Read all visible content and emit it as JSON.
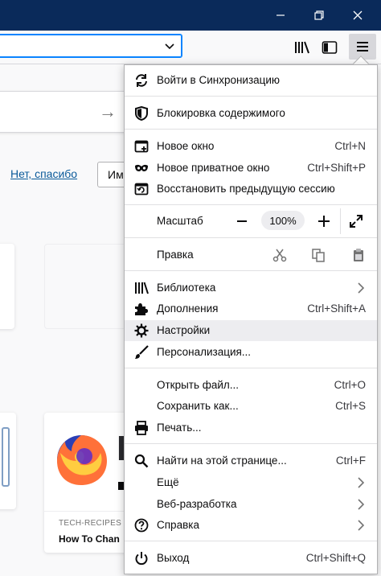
{
  "page": {
    "no_thanks": "Нет, спасибо",
    "partial_button": "Им",
    "card_source": "TECH-RECIPES",
    "card_title": "How To Chan",
    "card_big_letter": "F"
  },
  "menu": {
    "sync": "Войти в Синхронизацию",
    "content_blocking": "Блокировка содержимого",
    "new_window": "Новое окно",
    "new_window_sc": "Ctrl+N",
    "private_window": "Новое приватное окно",
    "private_window_sc": "Ctrl+Shift+P",
    "restore_session": "Восстановить предыдущую сессию",
    "zoom_label": "Масштаб",
    "zoom_value": "100%",
    "edit_label": "Правка",
    "library": "Библиотека",
    "addons": "Дополнения",
    "addons_sc": "Ctrl+Shift+A",
    "settings": "Настройки",
    "customize": "Персонализация...",
    "open_file": "Открыть файл...",
    "open_file_sc": "Ctrl+O",
    "save_as": "Сохранить как...",
    "save_as_sc": "Ctrl+S",
    "print": "Печать...",
    "find": "Найти на этой странице...",
    "find_sc": "Ctrl+F",
    "more": "Ещё",
    "web_dev": "Веб-разработка",
    "help": "Справка",
    "exit": "Выход",
    "exit_sc": "Ctrl+Shift+Q"
  },
  "colors": {
    "titlebar": "#0a2a5a",
    "highlight": "#ededf0",
    "accent": "#0a84ff"
  }
}
